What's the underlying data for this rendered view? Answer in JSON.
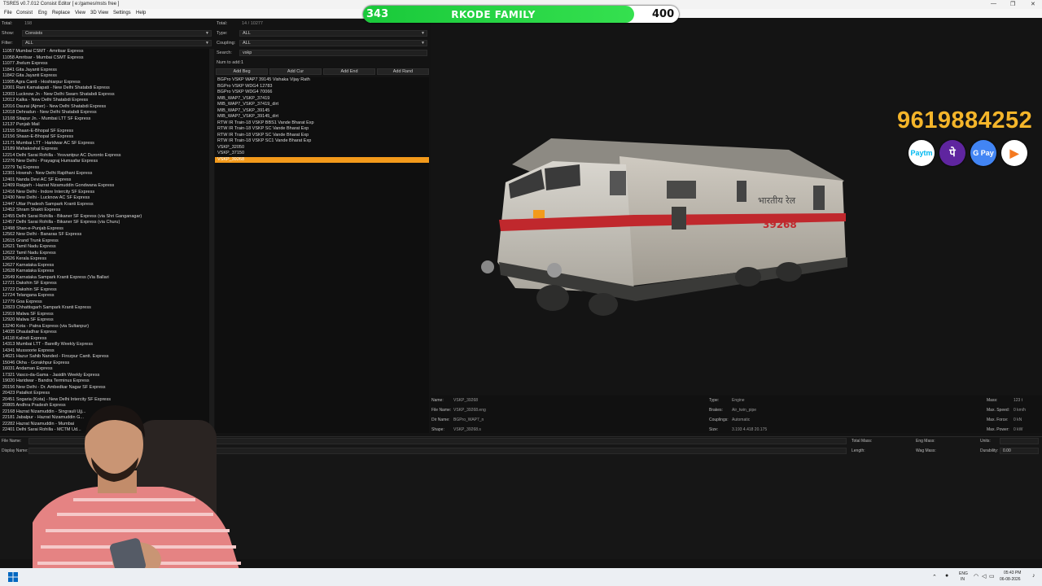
{
  "window": {
    "title": "TSRE5 v0.7.012 Consist Editor  [ e:/games/msts free ]",
    "controls": [
      "—",
      "❐",
      "✕"
    ]
  },
  "menu": [
    "File",
    "Consist",
    "Eng",
    "Replace",
    "View",
    "3D View",
    "Settings",
    "Help"
  ],
  "banner": {
    "left_count": "343",
    "name": "RKODE FAMILY",
    "right_count": "400",
    "progress": 0.8575
  },
  "left_panel": {
    "total_label": "Total:",
    "total_value": "198",
    "show_label": "Show:",
    "show_value": "Consists",
    "filter_label": "Filter:",
    "filter_value": "ALL",
    "consists": [
      "11057 Mumbai CSMT - Amritsar Express",
      "11058 Amritsar - Mumbai CSMT Express",
      "11077 Jhelum Express",
      "11841 Gita Jayanti Express",
      "11842 Gita Jayanti Express",
      "11905 Agra Cantt - Hoshiarpur Express",
      "12001 Rani Kamalapati - New Delhi Shatabdi Express",
      "12003 Lucknow Jn - New Delhi Swarn Shatabdi Express",
      "12012 Kalka - New Delhi Shatabdi Express",
      "12016 Daurai (Ajmer) - New Delhi Shatabdi Express",
      "12018 Dehradun - New Delhi Shatabdi Express",
      "12108 Sitapur Jn. - Mumbai LTT SF Express",
      "12137 Punjab Mail",
      "12155 Shaan-E-Bhopal SF Express",
      "12156 Shaan-E-Bhopal SF Express",
      "12171 Mumbai LTT - Haridwar AC SF Express",
      "12189 Mahakoshal Express",
      "12214 Delhi Sarai Rohilla - Yesvantpur AC Duronto Express",
      "12276 New Delhi - Prayagraj Humsafar Express",
      "12279 Taj Express",
      "12301 Howrah - New Delhi Rajdhani Express",
      "12401 Nanda Devi AC SF Express",
      "12409 Raigarh - Hazrat Nizamuddin Gondwana Express",
      "12416 New Delhi - Indore Intercity SF Express",
      "12430 New Delhi - Lucknow AC SF Express",
      "12447 Uttar Pradesh Sampark Kranti Express",
      "12452 Shram Shakti Express",
      "12455 Delhi Sarai Rohilla - Bikaner SF Express (via Shri Ganganagar)",
      "12457 Delhi Sarai Rohilla - Bikaner SF Express (via Churu)",
      "12498 Shan-e-Punjab Express",
      "12562 New Delhi - Banaras SF Express",
      "12615 Grand Trunk Express",
      "12621 Tamil Nadu Express",
      "12622 Tamil Nadu Express",
      "12626 Kerala Express",
      "12627 Karnataka Express",
      "12628 Karnataka Express",
      "12649 Karnataka Sampark Kranti Express (Via Ballari",
      "12721 Dakshin SF Express",
      "12722 Dakshin SF Express",
      "12724 Telangana Express",
      "12779 Goa Express",
      "12823 Chhattisgarh Sampark Kranti Express",
      "12919 Malwa SF Express",
      "12920 Malwa SF Express",
      "13240 Kota - Patna Express (via Sultanpur)",
      "14035 Dhauladhar Express",
      "14118 Kalindi Express",
      "14313 Mumbai LTT - Bareilly Weekly Express",
      "14341 Mussoorie Express",
      "14621 Hazur Sahib Nanded - Firozpur Cantt. Express",
      "15046 Okha - Gorakhpur Express",
      "16031 Andaman Express",
      "17321 Vasco-da-Gama - Jasidih Weekly Express",
      "19020 Haridwar - Bandra Terminus Express",
      "20156 New Delhi - Dr. Ambedkar Nagar SF Express",
      "20423 Patalkot Express",
      "20451 Sogaria (Kota) - New Delhi Intercity SF Express",
      "20805 Andhra Pradesh Express",
      "22168 Hazrat Nizamuddin - Singrauli Ujj...",
      "22181 Jabalpur - Hazrat Nizamuddin G...",
      "22282 Hazrat Nizamuddin - Mumbai",
      "22401 Delhi Sarai Rohilla - MCTM Ud..."
    ]
  },
  "middle_panel": {
    "total_label": "Total:",
    "total_value": "14 / 10277",
    "type_label": "Type:",
    "type_value": "ALL",
    "coupling_label": "Coupling:",
    "coupling_value": "ALL",
    "search_label": "Search:",
    "search_value": "vskp",
    "num_add_label": "Num to add:",
    "num_add_value": "1",
    "buttons": [
      "Add Beg",
      "Add Cur",
      "Add End",
      "Add Rand"
    ],
    "engines": [
      "BGPro VSKP WAP7 39145 Vishaka Vijay Rath",
      "BGPro VSKP WDG4 12783",
      "BGPro VSKP WDG4 70066",
      "MIB_WAP7_VSKP_37419",
      "MIB_WAP7_VSKP_37419_dirt",
      "MIB_WAP7_VSKP_39145",
      "MIB_WAP7_VSKP_39145_dirt",
      "RTW IR Train-18 VSKP BBS1 Vande Bharat Exp",
      "RTW IR Train-18 VSKP SC Vande Bharat Exp",
      "RTW IR Train-18 VSKP SC Vande Bharat Exp",
      "RTW IR Train-18 VSKP SC1 Vande Bharat Exp",
      "VSKP_32050",
      "VSKP_37150",
      "VSKP_39268"
    ],
    "selected_index": 13
  },
  "viewport": {
    "phone": "9619884252",
    "loco_number": "39268",
    "loco_script": "भारतीय रेल",
    "pay_icons": [
      {
        "name": "paytm",
        "label": "Paytm",
        "color": "#00b9f1"
      },
      {
        "name": "phonepe",
        "label": "पे",
        "color": "#5f259f"
      },
      {
        "name": "gpay",
        "label": "G Pay",
        "color": "#4285f4"
      },
      {
        "name": "bhim",
        "label": "▶",
        "color": "#f47920"
      }
    ]
  },
  "properties": {
    "name_label": "Name:",
    "name_value": "VSKP_39268",
    "file_label": "File Name:",
    "file_value": "VSKP_39268.eng",
    "dir_label": "Dir Name:",
    "dir_value": "BGPro_WAP7_n",
    "shape_label": "Shape:",
    "shape_value": "VSKP_39268.s",
    "type_label": "Type:",
    "type_value": "Engine",
    "brakes_label": "Brakes:",
    "brakes_value": "Air_twin_pipe",
    "couplings_label": "Couplings:",
    "couplings_value": "Automatic",
    "size_label": "Size:",
    "size_value": "3.193 4.418 20.175",
    "mass_label": "Mass:",
    "mass_value": "123 t",
    "maxspeed_label": "Max. Speed:",
    "maxspeed_value": "0 km/h",
    "maxforce_label": "Max. Force:",
    "maxforce_value": "0 kN",
    "maxpower_label": "Max. Power:",
    "maxpower_value": "0 kW"
  },
  "bottom": {
    "file_name_label": "File Name:",
    "display_name_label": "Display Name:",
    "total_mass_label": "Total Mass:",
    "length_label": "Length:",
    "eng_mass_label": "Eng Mass:",
    "wag_mass_label": "Wag Mass:",
    "units_label": "Units:",
    "durability_label": "Durability:",
    "durability_value": "0.00"
  },
  "taskbar": {
    "lang": "ENG",
    "region": "IN",
    "time": "05:43 PM",
    "date": "06-08-2026"
  }
}
